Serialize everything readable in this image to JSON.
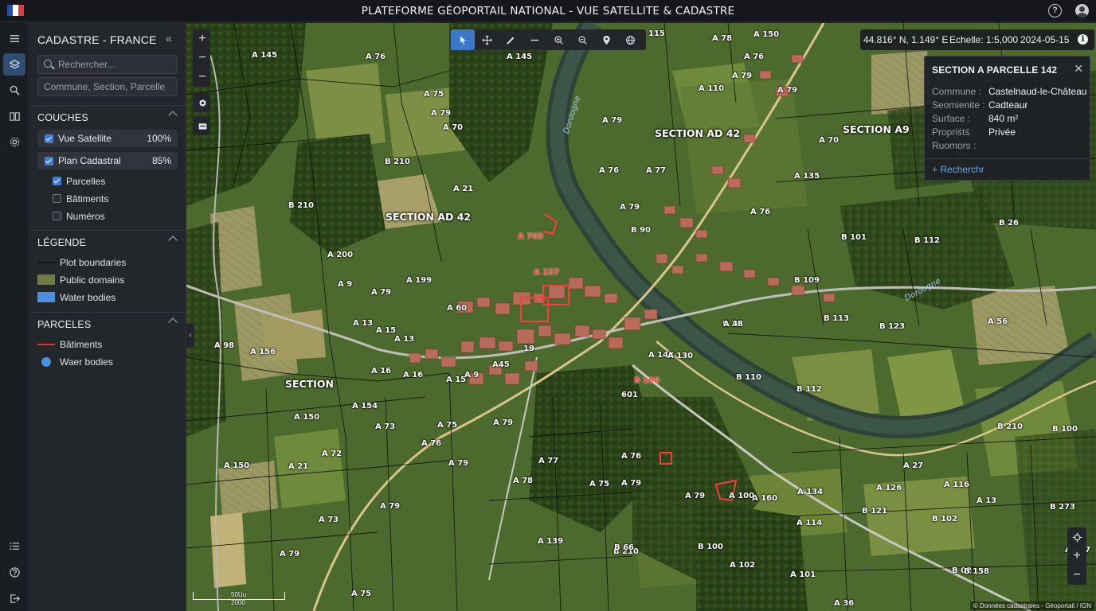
{
  "header": {
    "title": "PLATEFORME GÉOPORTAIL NATIONAL - VUE SATELLITE & CADASTRE",
    "flag_colors": [
      "#1f4fb0",
      "#ffffff",
      "#e03a3e"
    ]
  },
  "rail": {
    "icons": [
      "menu-icon",
      "layers-icon",
      "search-icon",
      "book-icon",
      "settings-icon",
      "list-icon",
      "help-icon",
      "logout-icon"
    ]
  },
  "panel": {
    "title": "CADASTRE - FRANCE",
    "search_placeholder": "Rechercher...",
    "commune_placeholder": "Commune, Section, Parcelle",
    "layers_heading": "COUCHES",
    "layers": [
      {
        "label": "Vue Satellite",
        "opacity": "100%",
        "checked": true
      },
      {
        "label": "Plan Cadastral",
        "opacity": "85%",
        "checked": true
      }
    ],
    "sublayers": [
      {
        "label": "Parcelles",
        "checked": true
      },
      {
        "label": "Bâtiments",
        "checked": false
      },
      {
        "label": "Numéros",
        "checked": false
      }
    ],
    "legend_heading": "LÉGENDE",
    "legend": [
      {
        "label": "Plot boundaries",
        "color": "#111111"
      },
      {
        "label": "Public domains",
        "color": "#6f7a45"
      },
      {
        "label": "Water bodies",
        "color": "#4a90e2"
      }
    ],
    "parcels_heading": "PARCELES",
    "parcels": [
      {
        "label": "Bâtiments",
        "color": "#e03434"
      },
      {
        "label": "Waer bodies",
        "color": "#4a90e2"
      }
    ]
  },
  "map": {
    "coords": "44.816° N, 1.149° E",
    "scale": "Echelle: 1:5,000",
    "date": "2024-05-15",
    "scalebar_top": "50Uu",
    "scalebar_bottom": "2000",
    "attribution": "© Données cadastrales - Géoportail / IGN",
    "sections": [
      {
        "text": "SECTION AD 42"
      },
      {
        "text": "SECTION AD 42"
      },
      {
        "text": "SECTION A9"
      },
      {
        "text": "SECTION"
      }
    ],
    "rivers": [
      "Dordogne",
      "Dordogne"
    ],
    "plots": [
      "A 145",
      "A 76",
      "A 145",
      "A 78",
      "115",
      "A 150",
      "A 76",
      "A 79",
      "A 110",
      "A 79",
      "A 75",
      "A 79",
      "A 70",
      "A 79",
      "A 76",
      "A 77",
      "A 135",
      "A 70",
      "B 210",
      "A 21",
      "B 210",
      "A 79",
      "B 90",
      "A 76",
      "A 200",
      "A 9",
      "A 199",
      "A 79",
      "A 60",
      "A 13",
      "A 15",
      "A 13",
      "A 156",
      "A 98",
      "A 16",
      "A 16",
      "A 15",
      "A 9",
      "A45",
      "19",
      "A 154",
      "A 150",
      "A 73",
      "A 75",
      "A 79",
      "A 72",
      "A 76",
      "A 79",
      "A 21",
      "A 150",
      "A 73",
      "A 75",
      "A 79",
      "A 79",
      "A 78",
      "A 139",
      "A 77",
      "A 76",
      "A 75",
      "A 79",
      "A 79",
      "A 160",
      "A 100",
      "A 114",
      "A 134",
      "A 126",
      "A 27",
      "A 116",
      "A 13",
      "B 273",
      "B 101",
      "B 112",
      "B 26",
      "B 109",
      "B 113",
      "B 123",
      "A 56",
      "B 10",
      "B 110",
      "B 112",
      "B 210",
      "B 100",
      "B 121",
      "B 102",
      "A 101",
      "A 102",
      "B 100",
      "B 02",
      "B 210",
      "B 66",
      "B 158",
      "A 127",
      "A 36",
      "A 48",
      "A 148",
      "A 130"
    ],
    "red_labels": [
      "A 705",
      "A 157",
      "B 160",
      "601"
    ]
  },
  "popup": {
    "title": "SECTION A PARCELLE 142",
    "rows": [
      {
        "key": "Commune :",
        "value": "Castelnaud-le-Château"
      },
      {
        "key": "Seomienite :",
        "value": "Cadteaur"
      },
      {
        "key": "Surface :",
        "value": "840 m²"
      },
      {
        "key": "Propriśtś",
        "value": "Privée"
      },
      {
        "key": "Ruomors :",
        "value": ""
      }
    ],
    "link": "Recherchr"
  }
}
